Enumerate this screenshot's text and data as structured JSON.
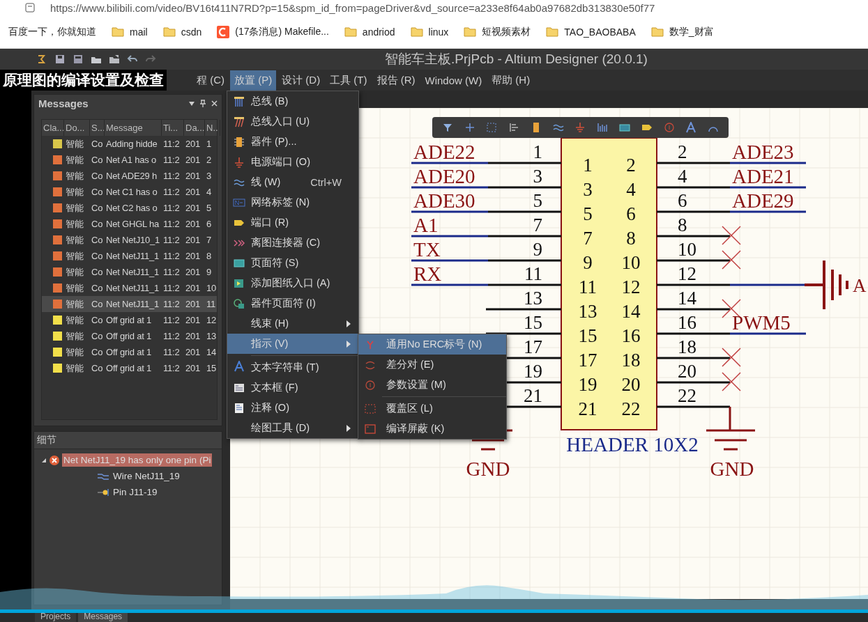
{
  "browser": {
    "url": "https://www.bilibili.com/video/BV16t411N7RD?p=15&spm_id_from=pageDriver&vd_source=a233e8f64ab0a97682db313830e50f77",
    "bookmarks": [
      {
        "kind": "site",
        "label": "百度一下，你就知道"
      },
      {
        "kind": "folder",
        "label": "mail"
      },
      {
        "kind": "folder",
        "label": "csdn"
      },
      {
        "kind": "csdn",
        "label": "(17条消息) Makefile..."
      },
      {
        "kind": "folder",
        "label": "andriod"
      },
      {
        "kind": "folder",
        "label": "linux"
      },
      {
        "kind": "folder",
        "label": "短视频素材"
      },
      {
        "kind": "folder",
        "label": "TAO_BAOBABA"
      },
      {
        "kind": "folder",
        "label": "数学_财富"
      }
    ]
  },
  "video_caption": "原理图的编译设置及检查",
  "window": {
    "title": "智能车主板.PrjPcb - Altium Designer (20.0.1)"
  },
  "menu_bar": [
    {
      "label": "程 (C)",
      "selected": false
    },
    {
      "label": "放置 (P)",
      "selected": true
    },
    {
      "label": "设计 (D)",
      "selected": false
    },
    {
      "label": "工具 (T)",
      "selected": false
    },
    {
      "label": "报告 (R)",
      "selected": false
    },
    {
      "label": "Window (W)",
      "selected": false
    },
    {
      "label": "帮助 (H)",
      "selected": false
    }
  ],
  "messages_panel": {
    "title": "Messages",
    "columns": [
      "Cla...",
      "Do...",
      "S...",
      "Message",
      "Ti...",
      "Da...",
      "N.."
    ],
    "rows": [
      {
        "color": "#d8c64a",
        "cells": [
          "",
          "智能",
          "Co",
          "Adding hidde",
          "11:2",
          "201",
          "1"
        ],
        "selected": false
      },
      {
        "color": "#e0703c",
        "cells": [
          "",
          "智能",
          "Co",
          "Net A1 has o",
          "11:2",
          "201",
          "2"
        ],
        "selected": false
      },
      {
        "color": "#e0703c",
        "cells": [
          "",
          "智能",
          "Co",
          "Net ADE29 h",
          "11:2",
          "201",
          "3"
        ],
        "selected": false
      },
      {
        "color": "#e0703c",
        "cells": [
          "",
          "智能",
          "Co",
          "Net C1 has o",
          "11:2",
          "201",
          "4"
        ],
        "selected": false
      },
      {
        "color": "#e0703c",
        "cells": [
          "",
          "智能",
          "Co",
          "Net C2 has o",
          "11:2",
          "201",
          "5"
        ],
        "selected": false
      },
      {
        "color": "#e0703c",
        "cells": [
          "",
          "智能",
          "Co",
          "Net GHGL ha",
          "11:2",
          "201",
          "6"
        ],
        "selected": false
      },
      {
        "color": "#e0703c",
        "cells": [
          "",
          "智能",
          "Co",
          "Net NetJ10_1",
          "11:2",
          "201",
          "7"
        ],
        "selected": false
      },
      {
        "color": "#e0703c",
        "cells": [
          "",
          "智能",
          "Co",
          "Net NetJ11_1",
          "11:2",
          "201",
          "8"
        ],
        "selected": false
      },
      {
        "color": "#e0703c",
        "cells": [
          "",
          "智能",
          "Co",
          "Net NetJ11_1",
          "11:2",
          "201",
          "9"
        ],
        "selected": false
      },
      {
        "color": "#e0703c",
        "cells": [
          "",
          "智能",
          "Co",
          "Net NetJ11_1",
          "11:2",
          "201",
          "10"
        ],
        "selected": false
      },
      {
        "color": "#e0703c",
        "cells": [
          "",
          "智能",
          "Co",
          "Net NetJ11_1",
          "11:2",
          "201",
          "11"
        ],
        "selected": true
      },
      {
        "color": "#f2df4a",
        "cells": [
          "",
          "智能",
          "Co",
          "Off grid  at 1",
          "11:2",
          "201",
          "12"
        ],
        "selected": false
      },
      {
        "color": "#f2df4a",
        "cells": [
          "",
          "智能",
          "Co",
          "Off grid  at 1",
          "11:2",
          "201",
          "13"
        ],
        "selected": false
      },
      {
        "color": "#f2df4a",
        "cells": [
          "",
          "智能",
          "Co",
          "Off grid  at 1",
          "11:2",
          "201",
          "14"
        ],
        "selected": false
      },
      {
        "color": "#f2df4a",
        "cells": [
          "",
          "智能",
          "Co",
          "Off grid  at 1",
          "11:2",
          "201",
          "15"
        ],
        "selected": false
      }
    ]
  },
  "details_panel": {
    "title": "细节",
    "tree": [
      {
        "kind": "error",
        "label": "Net NetJ11_19 has only one pin (Pi",
        "expanded": true,
        "selected": true,
        "children": [
          {
            "kind": "wire",
            "label": "Wire NetJ11_19"
          },
          {
            "kind": "pin",
            "label": "Pin J11-19"
          }
        ]
      }
    ]
  },
  "place_menu": {
    "groups": [
      [
        {
          "kind": "bus",
          "label": "总线 (B)",
          "submenu": false,
          "selected": false
        },
        {
          "kind": "bus-entry",
          "label": "总线入口 (U)",
          "submenu": false,
          "selected": false
        },
        {
          "kind": "part",
          "label": "器件 (P)...",
          "submenu": false,
          "selected": false
        },
        {
          "kind": "power",
          "label": "电源端口 (O)",
          "submenu": false,
          "selected": false
        },
        {
          "kind": "wire",
          "label": "线 (W)",
          "shortcut": "Ctrl+W",
          "submenu": false,
          "selected": false
        },
        {
          "kind": "net",
          "label": "网络标签 (N)",
          "submenu": false,
          "selected": false
        },
        {
          "kind": "port",
          "label": "端口 (R)",
          "submenu": false,
          "selected": false
        },
        {
          "kind": "offsheet",
          "label": "离图连接器 (C)",
          "submenu": false,
          "selected": false
        },
        {
          "kind": "sheet",
          "label": "页面符 (S)",
          "submenu": false,
          "selected": false
        },
        {
          "kind": "entry",
          "label": "添加图纸入口 (A)",
          "submenu": false,
          "selected": false
        },
        {
          "kind": "device",
          "label": "器件页面符 (I)",
          "submenu": false,
          "selected": false
        },
        {
          "kind": "plain",
          "label": "线束 (H)",
          "submenu": true,
          "selected": false
        },
        {
          "kind": "plain",
          "label": "指示 (V)",
          "submenu": true,
          "selected": true
        }
      ],
      [
        {
          "kind": "text",
          "label": "文本字符串 (T)",
          "submenu": false,
          "selected": false
        },
        {
          "kind": "textframe",
          "label": "文本框 (F)",
          "submenu": false,
          "selected": false
        },
        {
          "kind": "note",
          "label": "注释 (O)",
          "submenu": false,
          "selected": false
        },
        {
          "kind": "plain",
          "label": "绘图工具 (D)",
          "submenu": true,
          "selected": false
        }
      ]
    ]
  },
  "indicator_submenu": {
    "groups": [
      [
        {
          "kind": "noerc",
          "label": "通用No ERC标号 (N)",
          "selected": true
        },
        {
          "kind": "diff",
          "label": "差分对 (E)",
          "selected": false
        },
        {
          "kind": "param",
          "label": "参数设置 (M)",
          "selected": false
        }
      ],
      [
        {
          "kind": "cover",
          "label": "覆盖区 (L)",
          "selected": false
        },
        {
          "kind": "mask",
          "label": "编译屏蔽 (K)",
          "selected": false
        }
      ]
    ]
  },
  "schematic": {
    "component": "HEADER 10X2",
    "left_pins": [
      {
        "number": "1",
        "inner": "1",
        "kind": "net",
        "net": "ADE22"
      },
      {
        "number": "3",
        "inner": "3",
        "kind": "net",
        "net": "ADE20"
      },
      {
        "number": "5",
        "inner": "5",
        "kind": "net",
        "net": "ADE30"
      },
      {
        "number": "7",
        "inner": "7",
        "kind": "net",
        "net": "A1"
      },
      {
        "number": "9",
        "inner": "9",
        "kind": "net",
        "net": "TX"
      },
      {
        "number": "11",
        "inner": "11",
        "kind": "net",
        "net": "RX"
      },
      {
        "number": "13",
        "inner": "13",
        "kind": "open"
      },
      {
        "number": "15",
        "inner": "15",
        "kind": "open"
      },
      {
        "number": "17",
        "inner": "17",
        "kind": "open"
      },
      {
        "number": "19",
        "inner": "19",
        "kind": "open"
      },
      {
        "number": "21",
        "inner": "21",
        "kind": "open"
      }
    ],
    "right_pins": [
      {
        "number": "2",
        "inner": "2",
        "kind": "net",
        "net": "ADE23"
      },
      {
        "number": "4",
        "inner": "4",
        "kind": "net",
        "net": "ADE21"
      },
      {
        "number": "6",
        "inner": "6",
        "kind": "net",
        "net": "ADE29"
      },
      {
        "number": "8",
        "inner": "8",
        "kind": "no_erc"
      },
      {
        "number": "10",
        "inner": "10",
        "kind": "no_erc"
      },
      {
        "number": "12",
        "inner": "12",
        "kind": "power"
      },
      {
        "number": "14",
        "inner": "14",
        "kind": "no_erc"
      },
      {
        "number": "16",
        "inner": "16",
        "kind": "net",
        "net": "PWM5"
      },
      {
        "number": "18",
        "inner": "18",
        "kind": "no_erc"
      },
      {
        "number": "20",
        "inner": "20",
        "kind": "no_erc"
      },
      {
        "number": "22",
        "inner": "22",
        "kind": "ground"
      }
    ],
    "power_label": "A",
    "left_ground_label": "GND",
    "right_ground_label": "GND"
  },
  "bottom_tabs": [
    {
      "label": "Projects",
      "selected": false
    },
    {
      "label": "Messages",
      "selected": true
    }
  ]
}
